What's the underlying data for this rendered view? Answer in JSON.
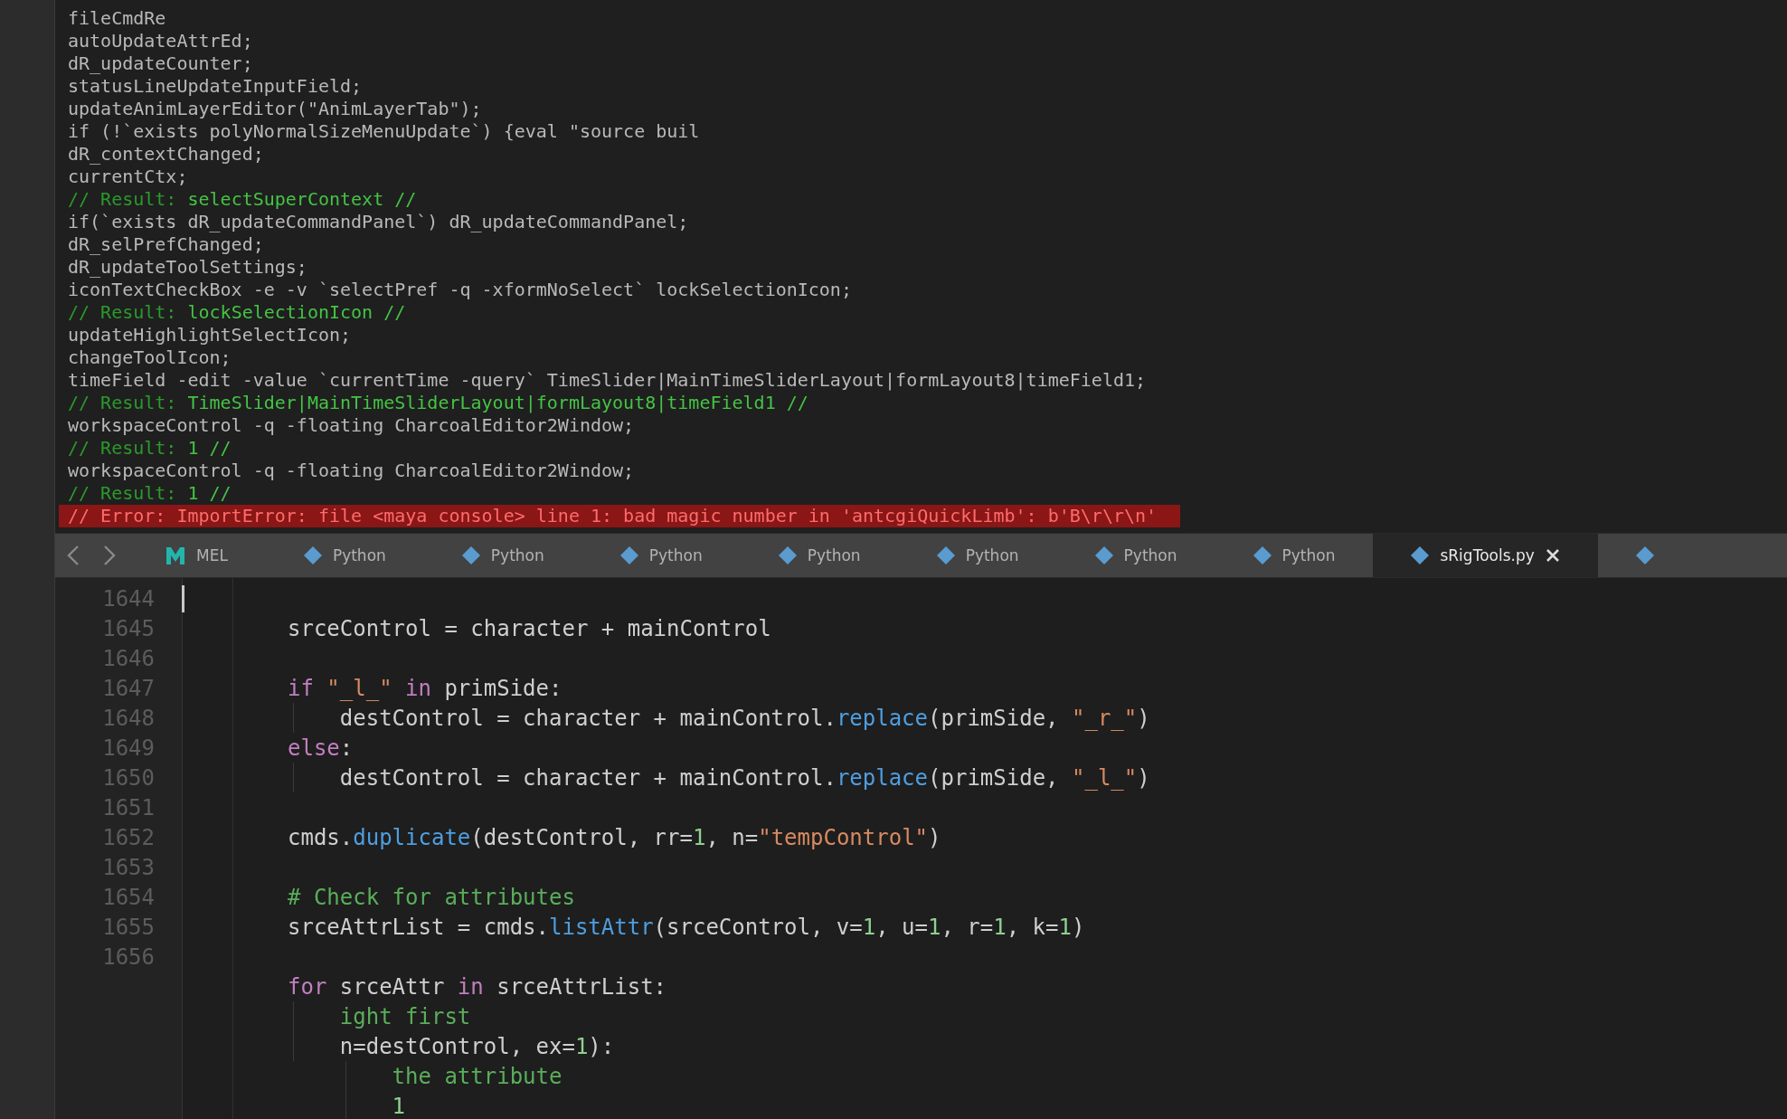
{
  "history": {
    "lines": [
      {
        "kind": "command",
        "text": "fileCmdRe"
      },
      {
        "kind": "command",
        "text": "autoUpdateAttrEd;"
      },
      {
        "kind": "command",
        "text": "dR_updateCounter;"
      },
      {
        "kind": "command",
        "text": "statusLineUpdateInputField;"
      },
      {
        "kind": "command",
        "text": "updateAnimLayerEditor(\"AnimLayerTab\");"
      },
      {
        "kind": "command",
        "text": "if (!`exists polyNormalSizeMenuUpdate`) {eval \"source buil"
      },
      {
        "kind": "command",
        "text": "dR_contextChanged;"
      },
      {
        "kind": "command",
        "text": "currentCtx;"
      },
      {
        "kind": "result",
        "prefix": "// Result:",
        "text": "selectSuperContext //"
      },
      {
        "kind": "command",
        "text": "if(`exists dR_updateCommandPanel`) dR_updateCommandPanel;"
      },
      {
        "kind": "command",
        "text": "dR_selPrefChanged;"
      },
      {
        "kind": "command",
        "text": "dR_updateToolSettings;"
      },
      {
        "kind": "command",
        "text": "iconTextCheckBox -e -v `selectPref -q -xformNoSelect` lockSelectionIcon;"
      },
      {
        "kind": "result",
        "prefix": "// Result:",
        "text": "lockSelectionIcon //"
      },
      {
        "kind": "command",
        "text": "updateHighlightSelectIcon;"
      },
      {
        "kind": "command",
        "text": "changeToolIcon;"
      },
      {
        "kind": "command",
        "text": "timeField -edit -value `currentTime -query` TimeSlider|MainTimeSliderLayout|formLayout8|timeField1;"
      },
      {
        "kind": "result",
        "prefix": "// Result:",
        "text": "TimeSlider|MainTimeSliderLayout|formLayout8|timeField1 //"
      },
      {
        "kind": "command",
        "text": "workspaceControl -q -floating CharcoalEditor2Window;"
      },
      {
        "kind": "result",
        "prefix": "// Result:",
        "text": "1 //"
      },
      {
        "kind": "command",
        "text": "workspaceControl -q -floating CharcoalEditor2Window;"
      },
      {
        "kind": "result",
        "prefix": "// Result:",
        "text": "1 //"
      },
      {
        "kind": "error",
        "text": "// Error: ImportError: file <maya console> line 1: bad magic number in 'antcgiQuickLimb': b'B\\r\\r\\n'"
      }
    ]
  },
  "tab_bar": {
    "tabs": [
      {
        "kind": "mel",
        "label": "MEL",
        "selected": false
      },
      {
        "kind": "python",
        "label": "Python",
        "selected": false
      },
      {
        "kind": "python",
        "label": "Python",
        "selected": false
      },
      {
        "kind": "python",
        "label": "Python",
        "selected": false
      },
      {
        "kind": "python",
        "label": "Python",
        "selected": false
      },
      {
        "kind": "python",
        "label": "Python",
        "selected": false
      },
      {
        "kind": "python",
        "label": "Python",
        "selected": false
      },
      {
        "kind": "python",
        "label": "Python",
        "selected": false
      },
      {
        "kind": "python",
        "label": "sRigTools.py",
        "selected": true
      },
      {
        "kind": "python",
        "selected": false
      }
    ]
  },
  "editor": {
    "lines": [
      {
        "number": "1644",
        "cursor": true
      },
      {
        "number": "1645",
        "cursor": false,
        "tokens": [
          {
            "kind": "plain",
            "text": "srceControl = character + mainControl"
          }
        ]
      },
      {
        "number": "1646",
        "cursor": false
      },
      {
        "number": "1647",
        "cursor": false,
        "tokens": [
          {
            "kind": "keyword",
            "text": "if "
          },
          {
            "kind": "string",
            "text": "\"_l_\" "
          },
          {
            "kind": "keyword",
            "text": "in"
          },
          {
            "kind": "plain",
            "text": " primSide:"
          }
        ],
        "children": [
          {
            "number": "1648",
            "cursor": false,
            "tokens": [
              {
                "kind": "plain",
                "text": "destControl = character + mainControl."
              },
              {
                "kind": "call",
                "text": "replace"
              },
              {
                "kind": "plain",
                "text": "(primSide, "
              },
              {
                "kind": "string",
                "text": "\"_r_\""
              },
              {
                "kind": "plain",
                "text": ")"
              }
            ]
          }
        ]
      },
      {
        "number": "1649",
        "cursor": false,
        "tokens": [
          {
            "kind": "keyword",
            "text": "else"
          },
          {
            "kind": "plain",
            "text": ":"
          }
        ],
        "children": [
          {
            "number": "1650",
            "cursor": false,
            "tokens": [
              {
                "kind": "plain",
                "text": "destControl = character + mainControl."
              },
              {
                "kind": "call",
                "text": "replace"
              },
              {
                "kind": "plain",
                "text": "(primSide, "
              },
              {
                "kind": "string",
                "text": "\"_l_\""
              },
              {
                "kind": "plain",
                "text": ")"
              }
            ]
          }
        ]
      },
      {
        "number": "1651",
        "cursor": false
      },
      {
        "number": "1652",
        "cursor": false,
        "tokens": [
          {
            "kind": "plain",
            "text": "cmds."
          },
          {
            "kind": "call",
            "text": "duplicate"
          },
          {
            "kind": "plain",
            "text": "(destControl, rr="
          },
          {
            "kind": "number",
            "text": "1"
          },
          {
            "kind": "plain",
            "text": ", n="
          },
          {
            "kind": "string",
            "text": "\"tempControl\""
          },
          {
            "kind": "plain",
            "text": ")"
          }
        ]
      },
      {
        "number": "1653",
        "cursor": false
      },
      {
        "number": "1654",
        "cursor": false,
        "tokens": [
          {
            "kind": "comment",
            "text": "# Check for attributes"
          }
        ]
      },
      {
        "number": "1655",
        "cursor": false,
        "tokens": [
          {
            "kind": "plain",
            "text": "srceAttrList = cmds."
          },
          {
            "kind": "call",
            "text": "listAttr"
          },
          {
            "kind": "plain",
            "text": "(srceControl, v="
          },
          {
            "kind": "number",
            "text": "1"
          },
          {
            "kind": "plain",
            "text": ", u="
          },
          {
            "kind": "number",
            "text": "1"
          },
          {
            "kind": "plain",
            "text": ", r="
          },
          {
            "kind": "number",
            "text": "1"
          },
          {
            "kind": "plain",
            "text": ", k="
          },
          {
            "kind": "number",
            "text": "1"
          },
          {
            "kind": "plain",
            "text": ")"
          }
        ]
      },
      {
        "number": "1656",
        "cursor": false
      },
      {
        "cursor": false,
        "tokens": [
          {
            "kind": "keyword",
            "text": "for"
          },
          {
            "kind": "plain",
            "text": " srceAttr "
          },
          {
            "kind": "keyword",
            "text": "in"
          },
          {
            "kind": "plain",
            "text": " srceAttrList:"
          }
        ],
        "children": [
          {
            "cursor": false,
            "tokens": [
              {
                "kind": "comment",
                "text": "ight first"
              }
            ]
          },
          {
            "cursor": false,
            "tokens": [
              {
                "kind": "plain",
                "text": "n=destControl, ex="
              },
              {
                "kind": "number",
                "text": "1"
              },
              {
                "kind": "plain",
                "text": "):"
              }
            ],
            "children": [
              {
                "cursor": false,
                "tokens": [
                  {
                    "kind": "comment",
                    "text": "the attribute"
                  }
                ]
              },
              {
                "cursor": false,
                "tokens": [
                  {
                    "kind": "number",
                    "text": "1"
                  }
                ]
              }
            ]
          }
        ]
      }
    ]
  }
}
